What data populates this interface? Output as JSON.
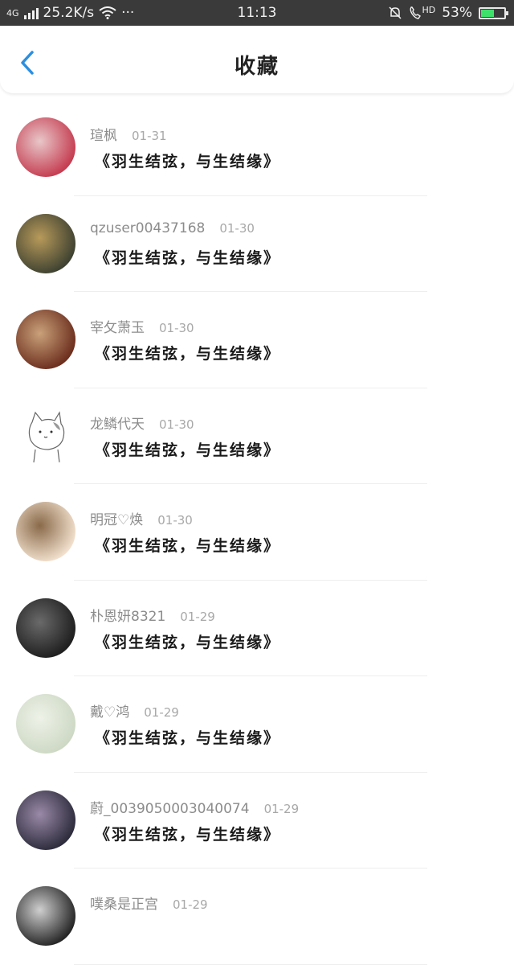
{
  "status_bar": {
    "network": "4G",
    "speed": "25.2K/s",
    "dots": "···",
    "time": "11:13",
    "hd": "HD",
    "battery_percent": "53%",
    "battery_level": 0.53
  },
  "header": {
    "title": "收藏"
  },
  "items": [
    {
      "user": "瑄枫",
      "date": "01-31",
      "content": "《羽生结弦，与生结缘》",
      "avatar": [
        "#c43a4e",
        "#e8c7c9"
      ]
    },
    {
      "user": "qzuser00437168",
      "date": "01-30",
      "content": "《羽生结弦，与生结缘》",
      "avatar": [
        "#3c4030",
        "#b89a5a"
      ]
    },
    {
      "user": "宰攵萧玉",
      "date": "01-30",
      "content": "《羽生结弦，与生结缘》",
      "avatar": [
        "#6b2c1c",
        "#c9a17a"
      ]
    },
    {
      "user": "龙鳞代天",
      "date": "01-30",
      "content": "《羽生结弦，与生结缘》",
      "avatar": [
        "#ffffff",
        "#dddddd"
      ]
    },
    {
      "user": "明冠♡焕",
      "date": "01-30",
      "content": "《羽生结弦，与生结缘》",
      "avatar": [
        "#f3e2cf",
        "#8a6a4a"
      ]
    },
    {
      "user": "朴恩妍8321",
      "date": "01-29",
      "content": "《羽生结弦，与生结缘》",
      "avatar": [
        "#1d1d1d",
        "#6a6a6a"
      ]
    },
    {
      "user": "戴♡鸿",
      "date": "01-29",
      "content": "《羽生结弦，与生结缘》",
      "avatar": [
        "#cdd8c4",
        "#eef2e8"
      ]
    },
    {
      "user": "蔚_0039050003040074",
      "date": "01-29",
      "content": "《羽生结弦，与生结缘》",
      "avatar": [
        "#2b2a3a",
        "#9a8aa8"
      ]
    },
    {
      "user": "噗桑是正宫",
      "date": "01-29",
      "content": "",
      "avatar": [
        "#222222",
        "#cfcfcf"
      ]
    }
  ]
}
